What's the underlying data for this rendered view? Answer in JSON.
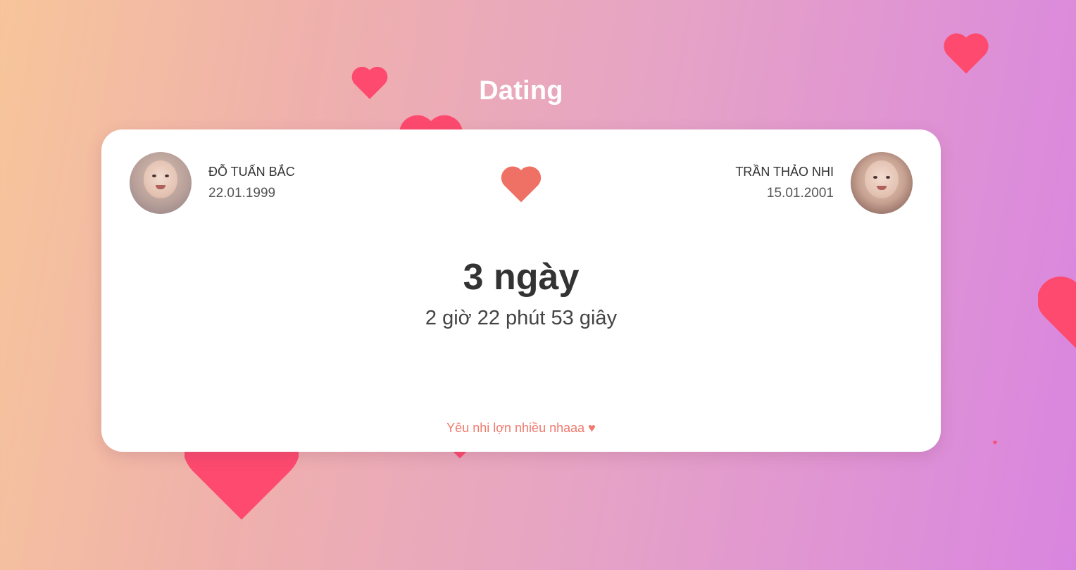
{
  "title": "Dating",
  "colors": {
    "heart_accent": "#ef7064",
    "floating_heart": "#fd4a6e",
    "footer_text": "#ef7a6d"
  },
  "left_person": {
    "name": "ĐỖ TUẤN BẮC",
    "birthdate": "22.01.1999",
    "avatar_icon": "baby-photo"
  },
  "right_person": {
    "name": "TRẦN THẢO NHI",
    "birthdate": "15.01.2001",
    "avatar_icon": "baby-photo"
  },
  "center_icon": "heart-icon",
  "counter": {
    "days_label": "3 ngày",
    "time_label": "2 giờ 22 phút 53 giây"
  },
  "footer": {
    "message": "Yêu nhi lợn nhiều nhaaa ♥"
  }
}
